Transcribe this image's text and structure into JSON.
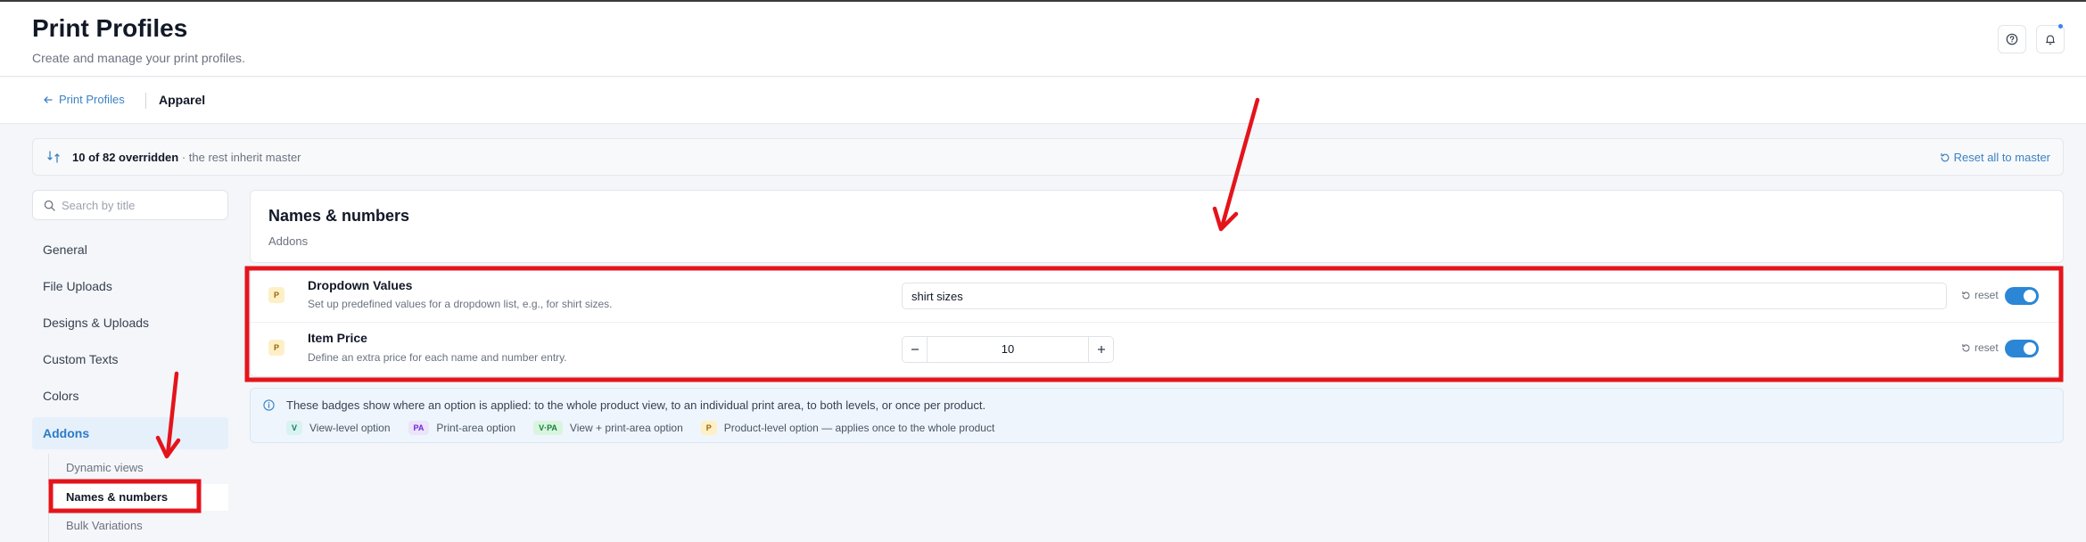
{
  "header": {
    "title": "Print Profiles",
    "subtitle": "Create and manage your print profiles."
  },
  "breadcrumb": {
    "back_label": "Print Profiles",
    "current": "Apparel"
  },
  "overrides": {
    "count": "10",
    "total_text": "of 82 overridden",
    "note": " · the rest inherit master",
    "reset_all_label": "Reset all to master"
  },
  "sidebar": {
    "search_placeholder": "Search by title",
    "items": [
      {
        "label": "General"
      },
      {
        "label": "File Uploads"
      },
      {
        "label": "Designs & Uploads"
      },
      {
        "label": "Custom Texts"
      },
      {
        "label": "Colors"
      },
      {
        "label": "Addons"
      }
    ],
    "sub_items": [
      {
        "label": "Dynamic views"
      },
      {
        "label": "Names & numbers"
      },
      {
        "label": "Bulk Variations"
      }
    ]
  },
  "section": {
    "title": "Names & numbers",
    "subtitle": "Addons"
  },
  "options": [
    {
      "badge": "P",
      "title": "Dropdown Values",
      "description": "Set up predefined values for a dropdown list, e.g., for shirt sizes.",
      "value": "shirt sizes",
      "reset_label": "reset",
      "enabled": true
    },
    {
      "badge": "P",
      "title": "Item Price",
      "description": "Define an extra price for each name and number entry.",
      "value": "10",
      "reset_label": "reset",
      "enabled": true
    }
  ],
  "info": {
    "text": "These badges show where an option is applied: to the whole product view, to an individual print area, to both levels, or once per product.",
    "legend": [
      {
        "badge": "V",
        "label": "View-level option"
      },
      {
        "badge": "PA",
        "label": "Print-area option"
      },
      {
        "badge": "V·PA",
        "label": "View + print-area option"
      },
      {
        "badge": "P",
        "label": "Product-level option — applies once to the whole product"
      }
    ]
  },
  "colors": {
    "accent": "#2b86d6",
    "annotation": "#e4141b",
    "active_nav_bg": "#e6f0fb"
  }
}
